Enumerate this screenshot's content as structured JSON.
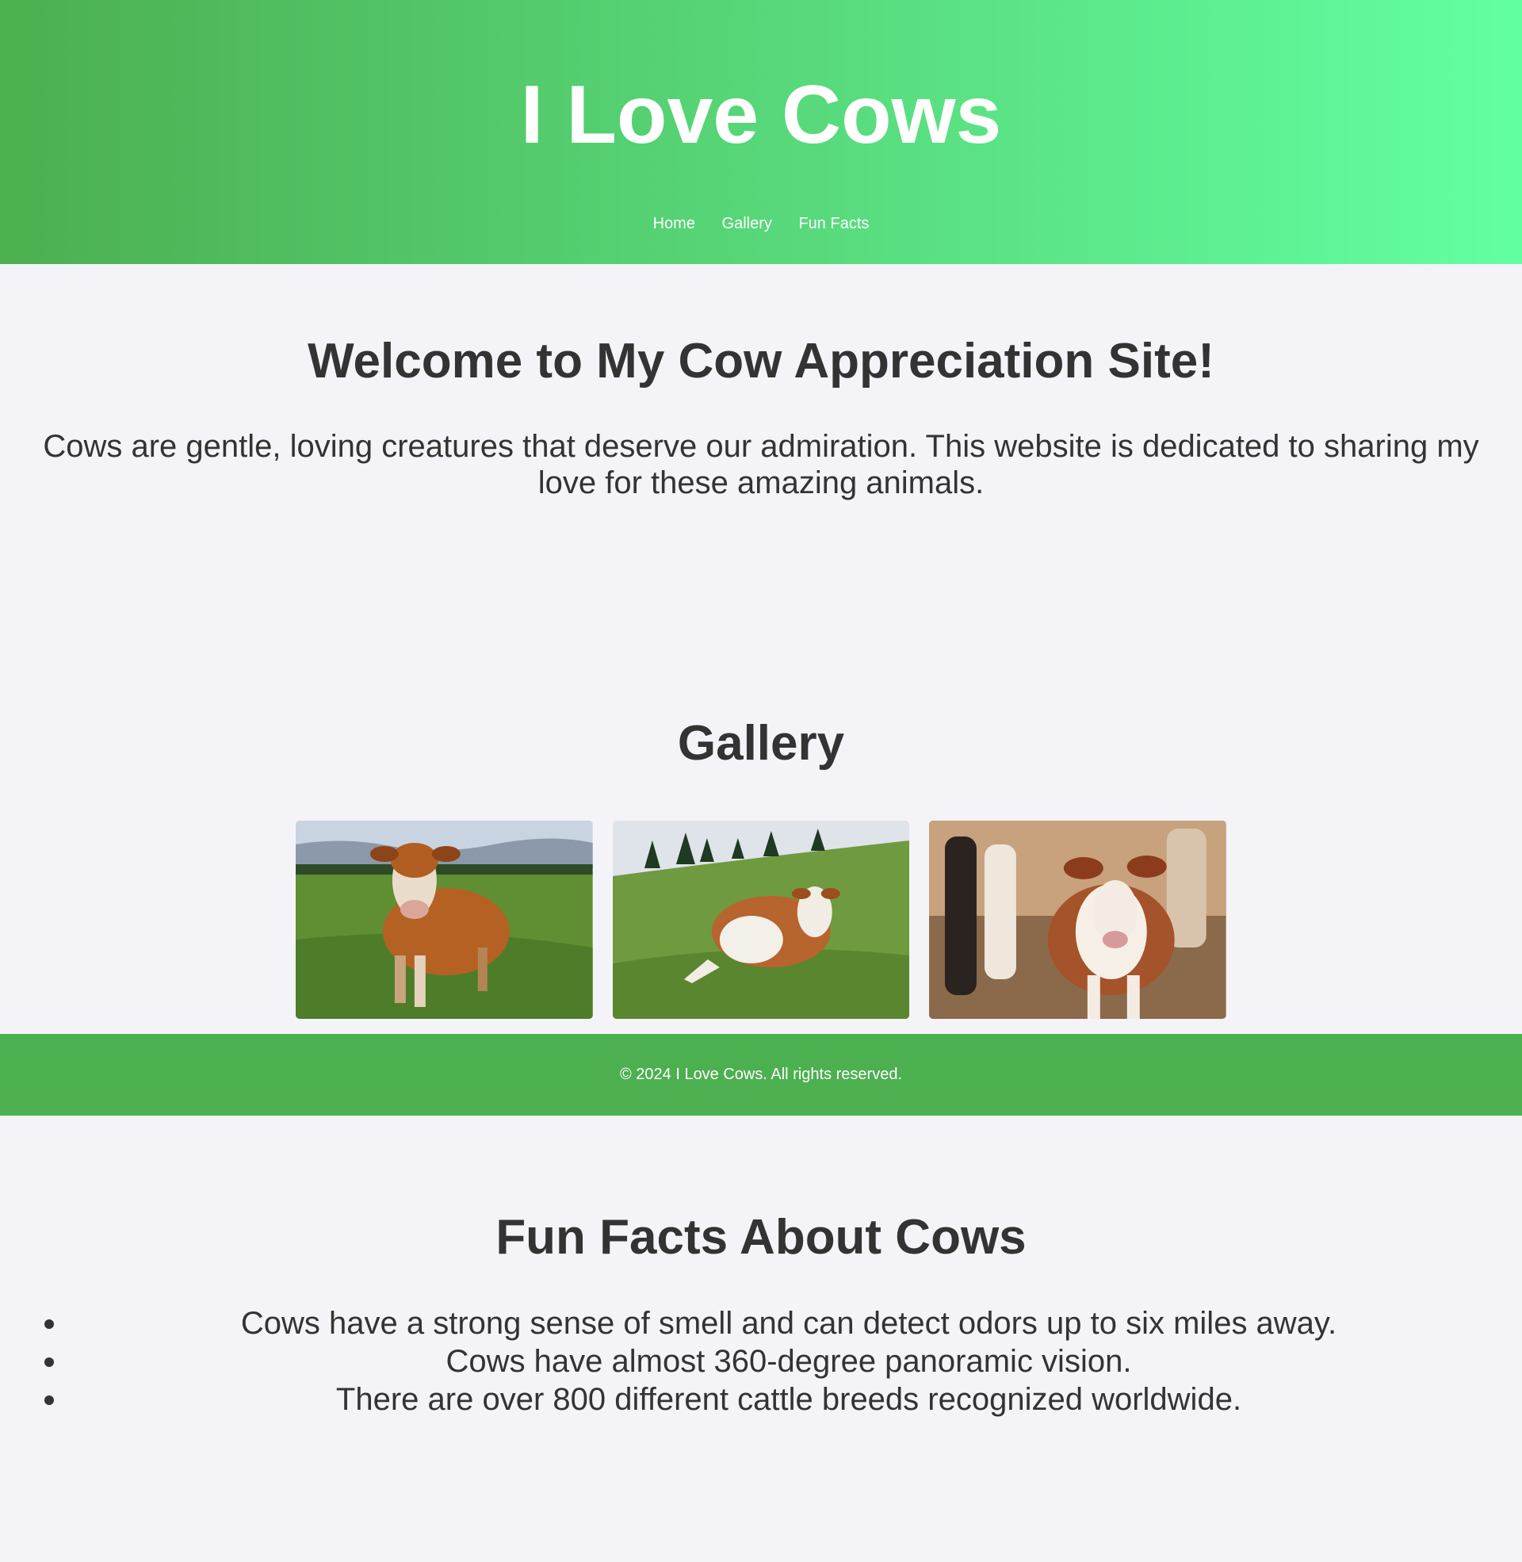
{
  "header": {
    "title": "I Love Cows",
    "nav": [
      "Home",
      "Gallery",
      "Fun Facts"
    ]
  },
  "welcome": {
    "heading": "Welcome to My Cow Appreciation Site!",
    "text": "Cows are gentle, loving creatures that deserve our admiration. This website is dedicated to sharing my love for these amazing animals."
  },
  "gallery": {
    "heading": "Gallery"
  },
  "footer": {
    "text": "© 2024 I Love Cows. All rights reserved."
  },
  "facts": {
    "heading": "Fun Facts About Cows",
    "items": [
      "Cows have a strong sense of smell and can detect odors up to six miles away.",
      "Cows have almost 360-degree panoramic vision.",
      "There are over 800 different cattle breeds recognized worldwide."
    ]
  },
  "colors": {
    "header_gradient_start": "#4caf50",
    "header_gradient_end": "#62ffa2",
    "footer": "#4caf50",
    "background": "#f4f4f8",
    "text": "#333333"
  }
}
